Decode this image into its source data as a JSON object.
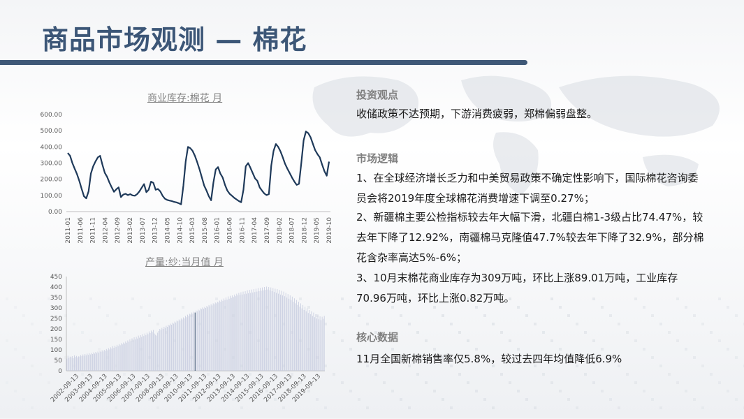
{
  "slide": {
    "title": "商品市场观测 — 棉花"
  },
  "right_panel": {
    "view_heading": "投资观点",
    "view_text": "收储政策不达预期，下游消费疲弱，郑棉偏弱盘整。",
    "logic_heading": "市场逻辑",
    "logic_1": "1、在全球经济增长乏力和中美贸易政策不确定性影响下，国际棉花咨询委员会将2019年度全球棉花消费增速下调至0.27%；",
    "logic_2": "2、新疆棉主要公检指标较去年大幅下滑，北疆白棉1-3级占比74.47%，较去年下降了12.92%，南疆棉马克隆值47.7%较去年下降了32.9%，部分棉花含杂率高达5%-6%；",
    "logic_3": "3、10月末棉花商业库存为309万吨，环比上涨89.01万吨，工业库存70.96万吨，环比上涨0.82万吨。",
    "data_heading": "核心数据",
    "data_text": "11月全国新棉销售率仅5.8%，较过去四年均值降低6.9%"
  },
  "chart_data": [
    {
      "type": "line",
      "title": "商业库存:棉花 月",
      "y_tick_labels": [
        "0.00",
        "100.00",
        "200.00",
        "300.00",
        "400.00",
        "500.00",
        "600.00"
      ],
      "ylim": [
        0,
        600
      ],
      "x_tick_labels": [
        "2011-01",
        "2011-06",
        "2011-11",
        "2012-04",
        "2012-09",
        "2013-02",
        "2013-07",
        "2013-12",
        "2014-05",
        "2014-10",
        "2015-03",
        "2015-08",
        "2016-01",
        "2016-06",
        "2016-11",
        "2017-04",
        "2017-09",
        "2018-02",
        "2018-07",
        "2018-12",
        "2019-05",
        "2019-10"
      ],
      "grid": false,
      "color": "#1f3a5a",
      "series": [
        {
          "values": [
            362,
            345,
            300,
            265,
            232,
            190,
            140,
            95,
            82,
            125,
            235,
            280,
            310,
            335,
            345,
            290,
            240,
            215,
            180,
            150,
            122,
            138,
            150,
            90,
            105,
            110,
            102,
            108,
            100,
            98,
            108,
            125,
            148,
            170,
            120,
            135,
            185,
            178,
            135,
            140,
            125,
            98,
            80,
            72,
            68,
            65,
            60,
            57,
            52,
            45,
            160,
            310,
            400,
            392,
            375,
            345,
            305,
            260,
            210,
            160,
            130,
            95,
            70,
            180,
            260,
            275,
            235,
            210,
            165,
            130,
            110,
            98,
            85,
            75,
            65,
            58,
            135,
            280,
            300,
            270,
            238,
            205,
            190,
            150,
            130,
            112,
            102,
            108,
            285,
            375,
            418,
            400,
            372,
            335,
            295,
            265,
            238,
            210,
            185,
            165,
            172,
            300,
            440,
            495,
            485,
            460,
            420,
            380,
            355,
            335,
            290,
            250,
            222,
            309
          ]
        }
      ]
    },
    {
      "type": "bar",
      "title": "产量:纱:当月值 月",
      "y_tick_labels": [
        "0",
        "50",
        "100",
        "150",
        "200",
        "250",
        "300",
        "350",
        "400",
        "450"
      ],
      "ylim": [
        0,
        450
      ],
      "x_tick_labels": [
        "2002-09-13",
        "2003-09-13",
        "2004-09-13",
        "2005-09-13",
        "2006-09-13",
        "2007-09-13",
        "2008-09-13",
        "2009-09-13",
        "2010-09-13",
        "2011-09-13",
        "2012-09-13",
        "2013-09-13",
        "2014-09-13",
        "2015-09-13",
        "2016-09-13",
        "2017-09-13",
        "2018-09-13",
        "2019-09-13"
      ],
      "grid": false,
      "color": "#c8cde0",
      "highlight_color": "#1f3a5a",
      "series": [
        {
          "values": [
            58,
            72,
            62,
            68,
            65,
            70,
            60,
            74,
            66,
            71,
            64,
            69,
            68,
            75,
            70,
            78,
            72,
            80,
            74,
            82,
            76,
            84,
            78,
            85,
            80,
            88,
            82,
            90,
            84,
            92,
            86,
            95,
            90,
            98,
            92,
            100,
            95,
            104,
            98,
            108,
            102,
            112,
            106,
            118,
            110,
            120,
            114,
            124,
            118,
            128,
            122,
            132,
            126,
            135,
            130,
            140,
            134,
            145,
            138,
            150,
            142,
            155,
            146,
            160,
            150,
            162,
            154,
            168,
            158,
            170,
            162,
            175,
            166,
            178,
            170,
            182,
            175,
            188,
            180,
            192,
            185,
            195,
            178,
            172,
            168,
            182,
            190,
            200,
            195,
            205,
            200,
            210,
            205,
            215,
            210,
            220,
            216,
            225,
            220,
            230,
            225,
            235,
            230,
            240,
            236,
            245,
            240,
            250,
            245,
            255,
            250,
            262,
            256,
            268,
            262,
            272,
            268,
            278,
            274,
            282,
            278,
            288,
            284,
            292,
            288,
            298,
            294,
            302,
            296,
            305,
            300,
            310,
            304,
            314,
            308,
            318,
            312,
            322,
            318,
            326,
            322,
            330,
            326,
            335,
            330,
            340,
            334,
            345,
            338,
            350,
            340,
            355,
            344,
            358,
            348,
            360,
            352,
            364,
            356,
            368,
            360,
            372,
            362,
            375,
            364,
            378,
            366,
            380,
            368,
            384,
            370,
            386,
            372,
            388,
            374,
            390,
            376,
            392,
            378,
            395,
            380,
            396,
            382,
            398,
            384,
            400,
            386,
            402,
            388,
            400,
            384,
            398,
            380,
            395,
            376,
            392,
            372,
            390,
            368,
            386,
            364,
            382,
            360,
            378,
            356,
            372,
            350,
            366,
            344,
            360,
            338,
            354,
            330,
            346,
            322,
            338,
            314,
            330,
            306,
            322,
            298,
            314,
            290,
            306,
            284,
            298,
            276,
            290,
            270,
            284,
            262,
            278,
            256,
            270,
            250,
            265,
            246,
            260,
            242,
            258,
            248,
            262
          ]
        }
      ],
      "highlight_index": 120
    }
  ]
}
